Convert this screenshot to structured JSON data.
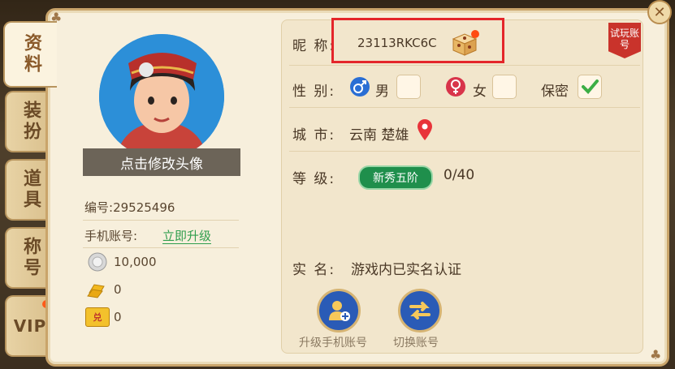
{
  "tabs": [
    {
      "label": "资料",
      "active": true
    },
    {
      "label": "装扮",
      "active": false
    },
    {
      "label": "道具",
      "active": false
    },
    {
      "label": "称号",
      "active": false
    },
    {
      "label": "VIP",
      "active": false,
      "badge": true
    }
  ],
  "profile": {
    "avatar_caption": "点击修改头像",
    "id_label": "编号:",
    "id_value": "29525496",
    "phone_label": "手机账号:",
    "phone_link": "立即升级",
    "coins": "10,000",
    "gold": "0",
    "vouchers": "0",
    "voucher_icon_text": "兑"
  },
  "info": {
    "nickname_label": "昵 称:",
    "nickname_value": "23113RKC6C",
    "gender_label": "性 别:",
    "male_label": "男",
    "female_label": "女",
    "secret_label": "保密",
    "gender_selected": "保密",
    "city_label": "城 市:",
    "city_value": "云南 楚雄",
    "level_label": "等 级:",
    "level_badge": "新秀五阶",
    "level_progress": "0/40",
    "realname_label": "实 名:",
    "realname_value": "游戏内已实名认证",
    "trial_tag": "试玩账号"
  },
  "actions": {
    "upgrade_label": "升级手机账号",
    "switch_label": "切换账号"
  },
  "colors": {
    "highlight": "#e4262a",
    "link_green": "#2f9e4d",
    "level_green": "#1f8f4c",
    "action_blue": "#2a5bb6"
  }
}
